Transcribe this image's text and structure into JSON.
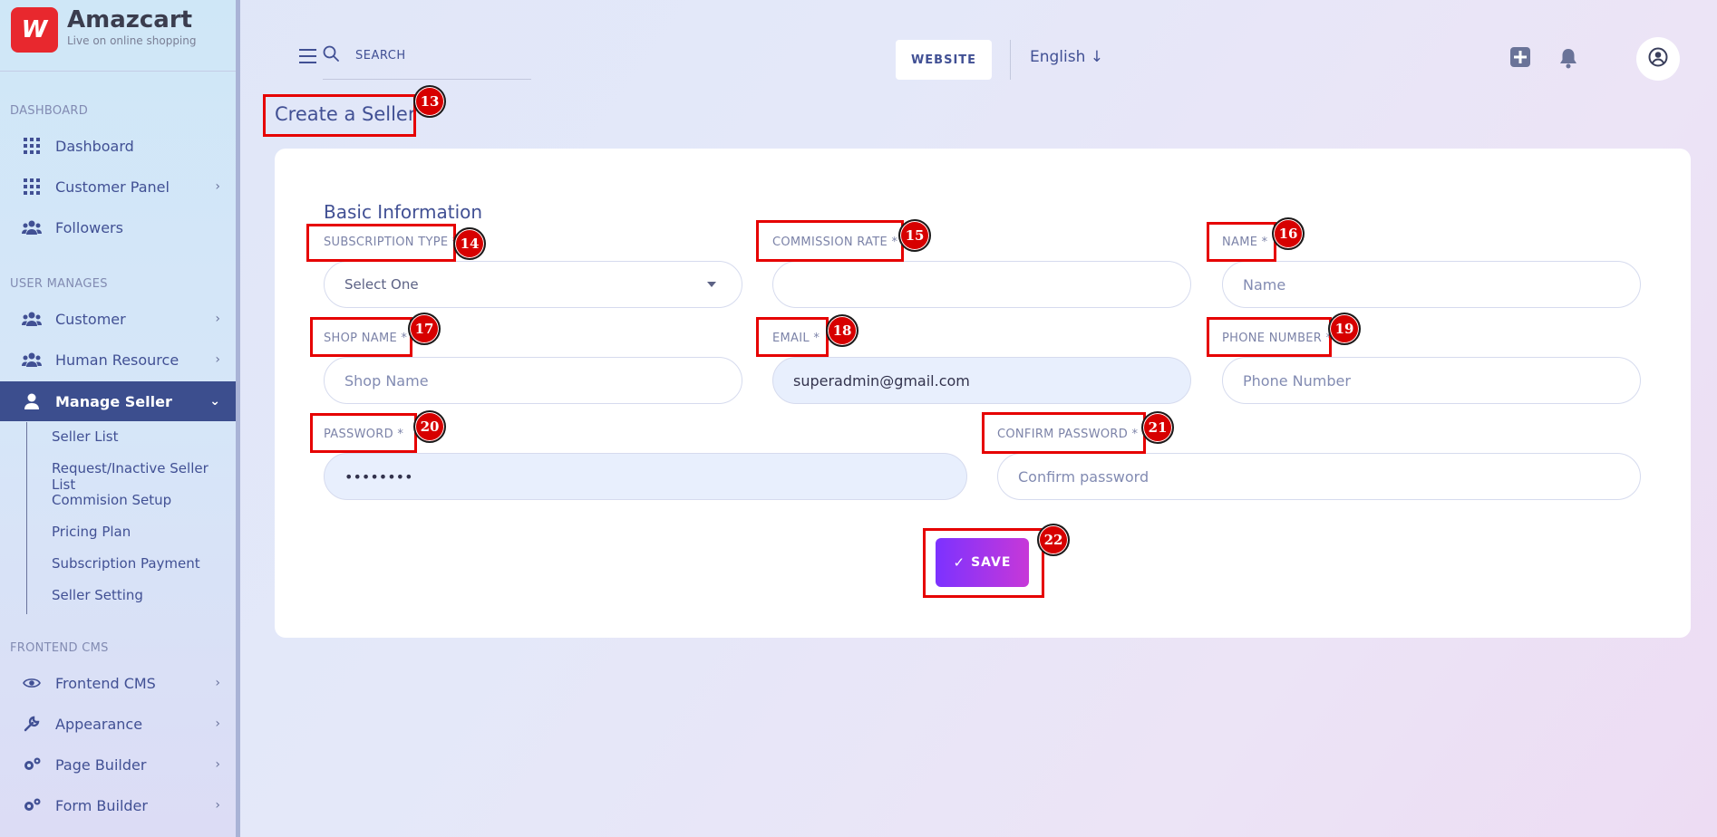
{
  "brand": {
    "name": "Amazcart",
    "tagline": "Live on online shopping",
    "logo_letter": "W",
    "logo_color": "#e8282e"
  },
  "sidebar": {
    "sections": [
      {
        "label": "DASHBOARD"
      },
      {
        "label": "USER MANAGES"
      },
      {
        "label": "FRONTEND CMS"
      }
    ],
    "items": [
      {
        "label": "Dashboard",
        "icon": "grid-icon"
      },
      {
        "label": "Customer Panel",
        "icon": "grid-icon",
        "chevron": "›"
      },
      {
        "label": "Followers",
        "icon": "users-icon"
      },
      {
        "label": "Customer",
        "icon": "users-icon",
        "chevron": "›"
      },
      {
        "label": "Human Resource",
        "icon": "users-icon",
        "chevron": "›"
      },
      {
        "label": "Manage Seller",
        "icon": "user-icon",
        "chevron": "⌄",
        "active": true
      },
      {
        "label": "Frontend CMS",
        "icon": "eye-icon",
        "chevron": "›"
      },
      {
        "label": "Appearance",
        "icon": "wrench-icon",
        "chevron": "›"
      },
      {
        "label": "Page Builder",
        "icon": "cogs-icon",
        "chevron": "›"
      },
      {
        "label": "Form Builder",
        "icon": "cogs-icon",
        "chevron": "›"
      }
    ],
    "sub_items": [
      "Seller List",
      "Request/Inactive Seller List",
      "Commision Setup",
      "Pricing Plan",
      "Subscription Payment",
      "Seller Setting"
    ]
  },
  "topbar": {
    "search_placeholder": "SEARCH",
    "website_label": "WEBSITE",
    "language": "English ↓"
  },
  "page": {
    "title": "Create a Seller",
    "section_heading": "Basic Information"
  },
  "form": {
    "subscription_type": {
      "label": "SUBSCRIPTION TYPE *",
      "value": "Select One"
    },
    "commission_rate": {
      "label": "COMMISSION RATE *",
      "value": "",
      "placeholder": ""
    },
    "name": {
      "label": "NAME *",
      "placeholder": "Name"
    },
    "shop_name": {
      "label": "SHOP NAME *",
      "placeholder": "Shop Name"
    },
    "email": {
      "label": "EMAIL *",
      "value": "superadmin@gmail.com"
    },
    "phone_number": {
      "label": "PHONE NUMBER *",
      "placeholder": "Phone Number"
    },
    "password": {
      "label": "PASSWORD *",
      "value": "••••••••"
    },
    "confirm_password": {
      "label": "CONFIRM PASSWORD *",
      "placeholder": "Confirm password"
    },
    "save": {
      "label": "SAVE",
      "check": "✓"
    }
  },
  "annotations": [
    "13",
    "14",
    "15",
    "16",
    "17",
    "18",
    "19",
    "20",
    "21",
    "22"
  ],
  "colors": {
    "accent": "#7c32ff",
    "accent_end": "#c738d8",
    "active_nav": "#3c4e8e",
    "text": "#415094",
    "annotation": "#e60000"
  }
}
